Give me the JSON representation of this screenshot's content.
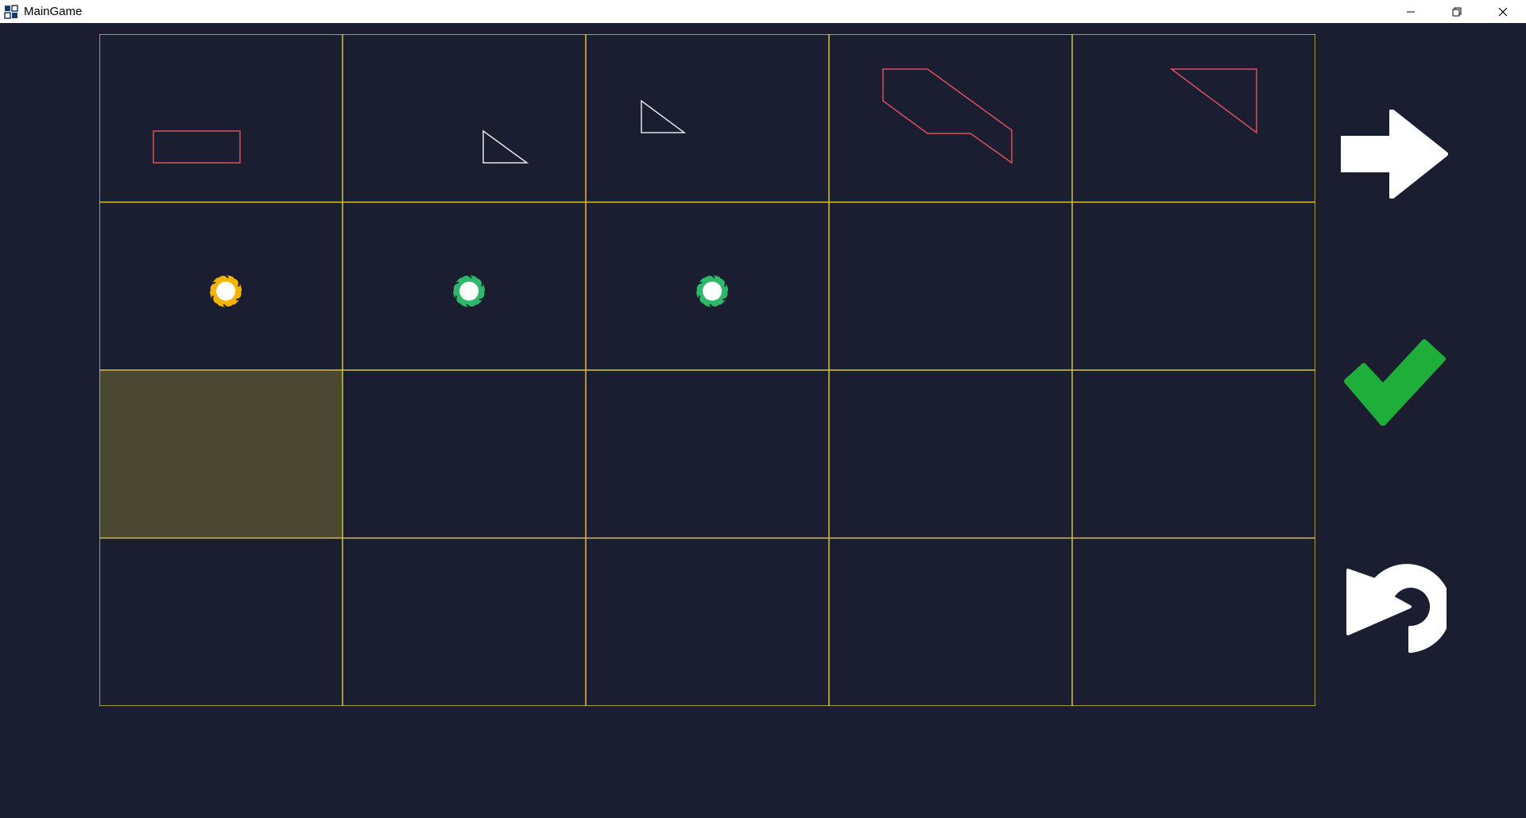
{
  "window": {
    "title": "MainGame",
    "controls": [
      "minimize-icon",
      "restore-icon",
      "close-icon"
    ]
  },
  "colors": {
    "background": "#1b1e30",
    "grid_line": "#d9c23a",
    "highlight_cell": "#4a4733",
    "shape_red": "#d9505f",
    "shape_white": "#e6e6e6",
    "orb_yellow": "#f4b400",
    "orb_green": "#2db86a",
    "confirm_green": "#1fae3a",
    "icon_white": "#ffffff"
  },
  "board": {
    "rows": 4,
    "cols": 5,
    "highlighted_cell": {
      "row": 2,
      "col": 0
    },
    "shape_cells": [
      {
        "row": 0,
        "col": 0,
        "shape": "rectangle",
        "color": "red"
      },
      {
        "row": 0,
        "col": 1,
        "shape": "right-triangle",
        "color": "white"
      },
      {
        "row": 0,
        "col": 2,
        "shape": "right-triangle",
        "color": "white"
      },
      {
        "row": 0,
        "col": 3,
        "shape": "hexagon-parallelogram",
        "color": "red"
      },
      {
        "row": 0,
        "col": 4,
        "shape": "right-triangle",
        "color": "red"
      }
    ],
    "orb_cells": [
      {
        "row": 1,
        "col": 0,
        "color": "yellow"
      },
      {
        "row": 1,
        "col": 1,
        "color": "green"
      },
      {
        "row": 1,
        "col": 2,
        "color": "green"
      }
    ]
  },
  "side_buttons": [
    {
      "name": "next-arrow-button",
      "icon": "arrow-right-icon"
    },
    {
      "name": "confirm-button",
      "icon": "checkmark-icon"
    },
    {
      "name": "reset-button",
      "icon": "undo-icon"
    }
  ]
}
